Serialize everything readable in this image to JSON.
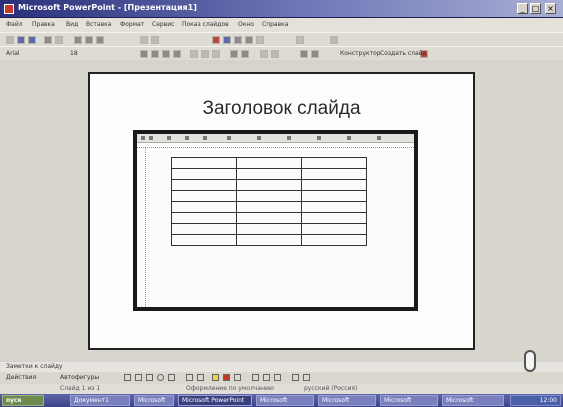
{
  "window": {
    "title": "Microsoft PowerPoint - [Презентация1]"
  },
  "menubar": [
    "Файл",
    "Правка",
    "Вид",
    "Вставка",
    "Формат",
    "Сервис",
    "Показ слайдов",
    "Окно",
    "Справка"
  ],
  "toolbar_row2": {
    "font": "Arial",
    "size": "18"
  },
  "toolbar_row3": {
    "design": "Конструктор",
    "new_slide": "Создать слайд"
  },
  "slide": {
    "title": "Заголовок слайда",
    "embedded_table": {
      "rows": 8,
      "cols": 3
    }
  },
  "notes": {
    "label": "Заметки к слайду"
  },
  "draw_toolbar": {
    "draw": "Действия",
    "autoshapes": "Автофигуры"
  },
  "status": {
    "slide": "Слайд 1 из 1",
    "design": "Оформление по умолчанию",
    "lang": "русский (Россия)"
  },
  "taskbar": {
    "start": "пуск",
    "tasks": [
      "Документ1",
      "Microsoft",
      "Microsoft PowerPoint",
      "Microsoft",
      "Microsoft",
      "Microsoft",
      "Microsoft"
    ],
    "clock": "12:00"
  }
}
